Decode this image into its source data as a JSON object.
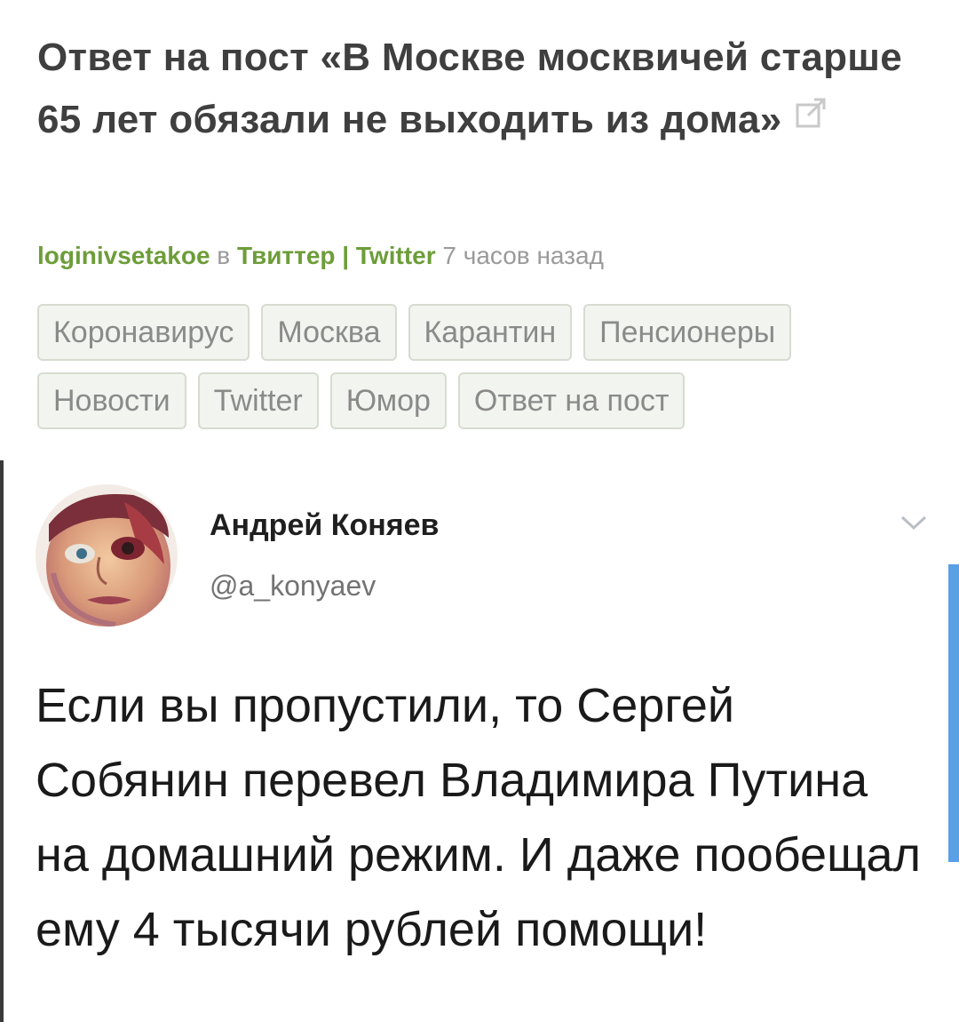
{
  "post": {
    "title": "Ответ на пост «В Москве москвичей старше 65 лет обязали не выходить из дома»",
    "external_link_icon": "external-link-icon",
    "author": "loginivsetakoe",
    "in_word": "в",
    "community": "Твиттер | Twitter",
    "time_ago": "7 часов назад",
    "tags_row1": [
      "Коронавирус",
      "Москва",
      "Карантин",
      "Пенсионеры"
    ],
    "tags_row2": [
      "Новости",
      "Twitter",
      "Юмор",
      "Ответ на пост"
    ]
  },
  "tweet": {
    "name": "Андрей Коняев",
    "handle": "@a_konyaev",
    "text": "Если вы пропустили, то Сергей Собянин перевел Владимира Путина на домашний режим. И даже пообещал ему 4 тысячи рублей помощи!",
    "menu_icon": "chevron-down-icon"
  },
  "colors": {
    "accent_green": "#6d9d39",
    "title": "#3f3f3f",
    "tag_bg": "#f2f4ef",
    "scrollbar": "#5aa0e6"
  }
}
